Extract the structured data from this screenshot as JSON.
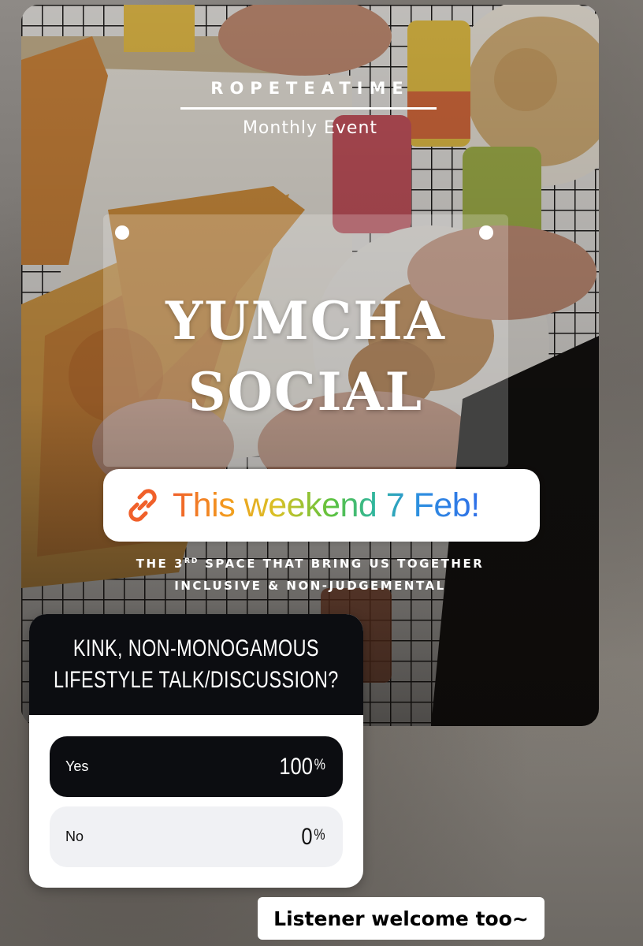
{
  "story": {
    "brand": "ROPETEATIME",
    "subtitle": "Monthly Event",
    "title_line1": "YUMCHA",
    "title_line2": "SOCIAL",
    "tagline_line1_pre": "THE 3",
    "tagline_line1_sup": "RD",
    "tagline_line1_post": " SPACE THAT BRING US TOGETHER",
    "tagline_line2": "INCLUSIVE & NON-JUDGEMENTAL",
    "background_image": "table-with-pizza-fried-chicken-drink-cans"
  },
  "link_sticker": {
    "icon": "link-icon",
    "label": "This weekend 7 Feb!"
  },
  "poll": {
    "question_line1": "KINK, NON-MONOGAMOUS",
    "question_line2": "LIFESTYLE TALK/DISCUSSION?",
    "options": [
      {
        "label": "Yes",
        "value": "100",
        "unit": "%",
        "share": 1.0
      },
      {
        "label": "No",
        "value": "0",
        "unit": "%",
        "share": 0.0
      }
    ]
  },
  "caption": {
    "text": "Listener welcome too~"
  },
  "colors": {
    "poll_dark": "#0c0d11",
    "poll_light_option": "#f0f1f4",
    "link_gradient_start": "#f0602a",
    "link_gradient_end": "#2f6fe8"
  }
}
